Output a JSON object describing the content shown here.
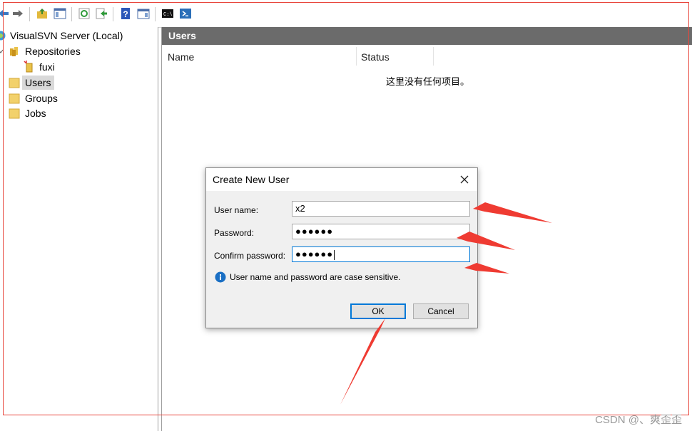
{
  "toolbar": {
    "buttons": [
      "back-icon",
      "forward-icon",
      "up-folder-icon",
      "show-hide-tree-icon",
      "refresh-icon",
      "export-icon",
      "help-icon",
      "properties-icon",
      "cmd-icon",
      "powershell-icon"
    ]
  },
  "tree": {
    "root": "VisualSVN Server (Local)",
    "repositories": "Repositories",
    "repo_fuxi": "fuxi",
    "users": "Users",
    "groups": "Groups",
    "jobs": "Jobs"
  },
  "main": {
    "header": "Users",
    "columns": [
      "Name",
      "Status"
    ],
    "empty_message": "这里没有任何项目。"
  },
  "dialog": {
    "title": "Create New User",
    "username_label": "User name:",
    "username_value": "x2",
    "password_label": "Password:",
    "password_value": "●●●●●●",
    "confirm_label": "Confirm password:",
    "confirm_value": "●●●●●●",
    "info_text": "User name and password are case sensitive.",
    "ok_label": "OK",
    "cancel_label": "Cancel"
  },
  "watermark": "CSDN @、爽歪歪",
  "colors": {
    "accent": "#0078d7",
    "annotation_red": "#e8463d",
    "header_bar": "#6b6b6b"
  }
}
